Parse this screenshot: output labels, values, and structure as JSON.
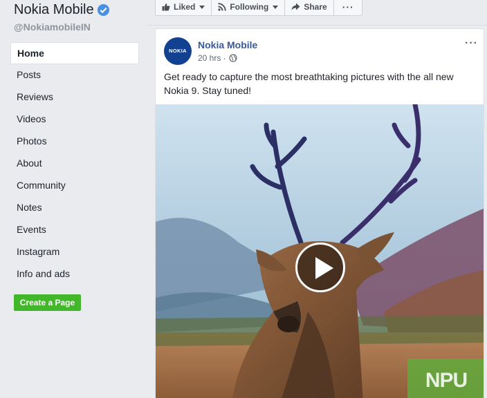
{
  "page": {
    "name": "Nokia Mobile",
    "handle": "@NokiamobileIN",
    "verified_icon": "verified-badge-icon"
  },
  "sidebar": {
    "items": [
      {
        "label": "Home",
        "active": true
      },
      {
        "label": "Posts"
      },
      {
        "label": "Reviews"
      },
      {
        "label": "Videos"
      },
      {
        "label": "Photos"
      },
      {
        "label": "About"
      },
      {
        "label": "Community"
      },
      {
        "label": "Notes"
      },
      {
        "label": "Events"
      },
      {
        "label": "Instagram"
      },
      {
        "label": "Info and ads"
      }
    ],
    "create_page_label": "Create a Page"
  },
  "actions": {
    "liked_label": "Liked",
    "following_label": "Following",
    "share_label": "Share",
    "more_label": "···"
  },
  "post": {
    "avatar_text": "NOKIA",
    "author": "Nokia Mobile",
    "time": "20 hrs ·",
    "menu_label": "···",
    "text": "Get ready to capture the most breathtaking pictures with the all new Nokia 9. Stay tuned!",
    "watermark": "NPU"
  },
  "colors": {
    "link": "#365899",
    "create_button": "#42b72a",
    "nokia_blue": "#124191"
  }
}
